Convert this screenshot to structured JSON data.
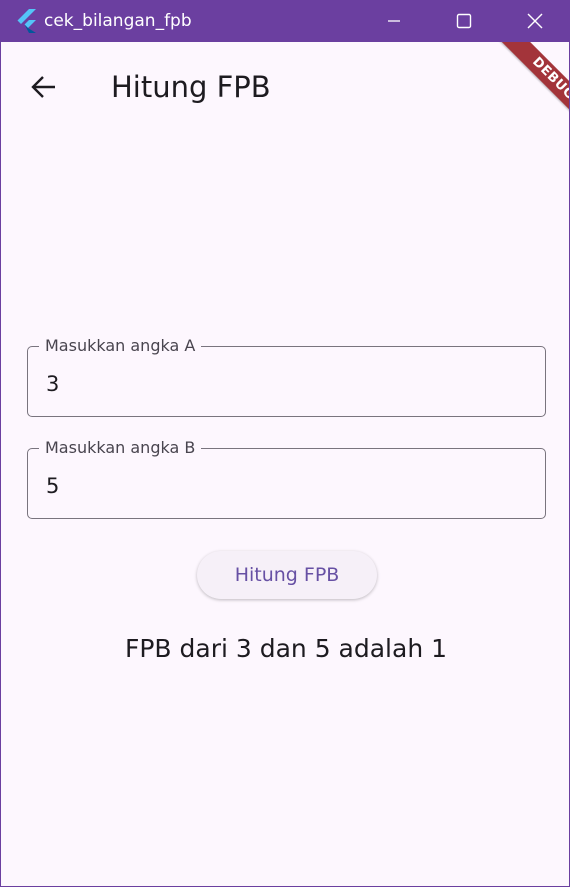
{
  "window": {
    "title": "cek_bilangan_fpb",
    "controls": {
      "minimize": "minimize-icon",
      "maximize": "maximize-icon",
      "close": "close-icon"
    }
  },
  "appbar": {
    "back_icon": "arrow-back-icon",
    "title": "Hitung FPB"
  },
  "debug_banner": "DEBUG",
  "form": {
    "field_a": {
      "label": "Masukkan angka A",
      "value": "3"
    },
    "field_b": {
      "label": "Masukkan angka B",
      "value": "5"
    },
    "button_label": "Hitung FPB"
  },
  "result": "FPB dari 3 dan 5 adalah 1",
  "colors": {
    "titlebar": "#6b3fa0",
    "background": "#fdf7fe",
    "primary": "#6750a4",
    "debug_ribbon": "#a3343a"
  }
}
